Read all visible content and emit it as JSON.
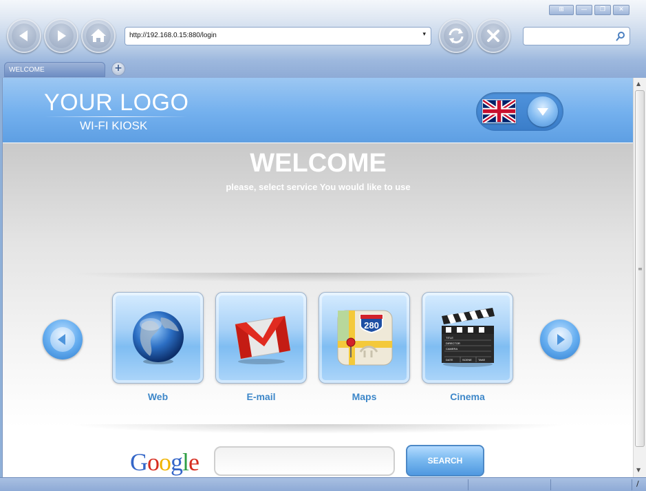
{
  "browser": {
    "window_buttons": [
      "⊞",
      "—",
      "❐",
      "✕"
    ],
    "url": "http://192.168.0.15:880/login",
    "url_dropdown": "▾",
    "search_placeholder": "",
    "tab_label": "WELCOME",
    "new_tab": "+",
    "nav_icons": [
      "back-icon",
      "forward-icon",
      "home-icon",
      "refresh-icon",
      "stop-icon"
    ],
    "status_text": "/"
  },
  "page": {
    "logo_main": "YOUR LOGO",
    "logo_sub": "WI-FI KIOSK",
    "language_icon": "uk-flag-icon",
    "title": "WELCOME",
    "subtitle": "please, select service You would like to use",
    "services": [
      {
        "label": "Web",
        "icon": "globe-icon"
      },
      {
        "label": "E-mail",
        "icon": "gmail-icon"
      },
      {
        "label": "Maps",
        "icon": "maps-icon"
      },
      {
        "label": "Cinema",
        "icon": "clapperboard-icon"
      }
    ],
    "google_logo": "Google",
    "search_value": "",
    "search_button": "SEARCH",
    "map_shield": "280",
    "clapper_fields": [
      "TITLE",
      "DIRECTOR",
      "CAMERA",
      "DATE",
      "SCENE",
      "TAKE"
    ]
  },
  "colors": {
    "header_blue": "#73b0ee",
    "label_blue": "#3d87c9",
    "chrome_blue": "#8eabd6"
  }
}
